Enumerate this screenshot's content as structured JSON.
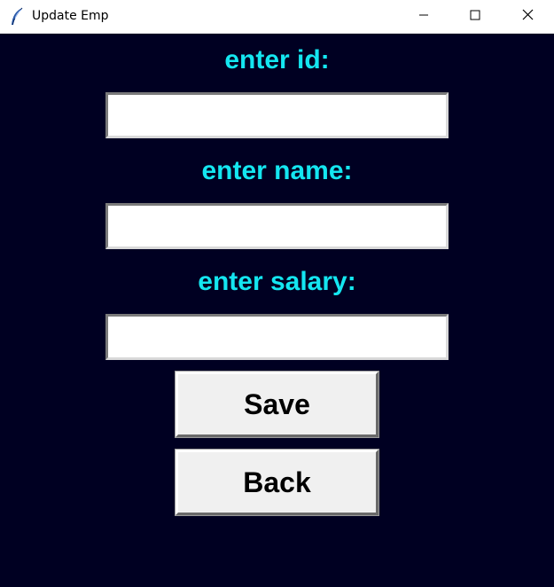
{
  "window": {
    "title": "Update Emp",
    "app_icon": "feather-icon",
    "controls": [
      "minimize-icon",
      "maximize-icon",
      "close-icon"
    ]
  },
  "form": {
    "id_label": "enter id:",
    "id_value": "",
    "name_label": "enter name:",
    "name_value": "",
    "salary_label": "enter salary:",
    "salary_value": "",
    "save_label": "Save",
    "back_label": "Back"
  },
  "colors": {
    "background": "#000022",
    "label": "#14e6f0",
    "button": "#f0f0f0"
  }
}
